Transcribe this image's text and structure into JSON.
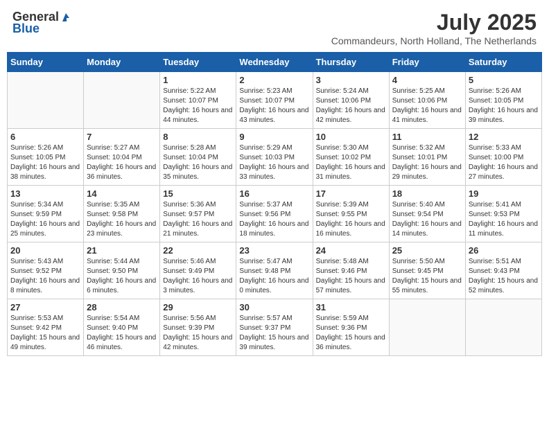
{
  "logo": {
    "general": "General",
    "blue": "Blue"
  },
  "title": "July 2025",
  "location": "Commandeurs, North Holland, The Netherlands",
  "weekdays": [
    "Sunday",
    "Monday",
    "Tuesday",
    "Wednesday",
    "Thursday",
    "Friday",
    "Saturday"
  ],
  "weeks": [
    [
      {
        "day": "",
        "info": ""
      },
      {
        "day": "",
        "info": ""
      },
      {
        "day": "1",
        "info": "Sunrise: 5:22 AM\nSunset: 10:07 PM\nDaylight: 16 hours\nand 44 minutes."
      },
      {
        "day": "2",
        "info": "Sunrise: 5:23 AM\nSunset: 10:07 PM\nDaylight: 16 hours\nand 43 minutes."
      },
      {
        "day": "3",
        "info": "Sunrise: 5:24 AM\nSunset: 10:06 PM\nDaylight: 16 hours\nand 42 minutes."
      },
      {
        "day": "4",
        "info": "Sunrise: 5:25 AM\nSunset: 10:06 PM\nDaylight: 16 hours\nand 41 minutes."
      },
      {
        "day": "5",
        "info": "Sunrise: 5:26 AM\nSunset: 10:05 PM\nDaylight: 16 hours\nand 39 minutes."
      }
    ],
    [
      {
        "day": "6",
        "info": "Sunrise: 5:26 AM\nSunset: 10:05 PM\nDaylight: 16 hours\nand 38 minutes."
      },
      {
        "day": "7",
        "info": "Sunrise: 5:27 AM\nSunset: 10:04 PM\nDaylight: 16 hours\nand 36 minutes."
      },
      {
        "day": "8",
        "info": "Sunrise: 5:28 AM\nSunset: 10:04 PM\nDaylight: 16 hours\nand 35 minutes."
      },
      {
        "day": "9",
        "info": "Sunrise: 5:29 AM\nSunset: 10:03 PM\nDaylight: 16 hours\nand 33 minutes."
      },
      {
        "day": "10",
        "info": "Sunrise: 5:30 AM\nSunset: 10:02 PM\nDaylight: 16 hours\nand 31 minutes."
      },
      {
        "day": "11",
        "info": "Sunrise: 5:32 AM\nSunset: 10:01 PM\nDaylight: 16 hours\nand 29 minutes."
      },
      {
        "day": "12",
        "info": "Sunrise: 5:33 AM\nSunset: 10:00 PM\nDaylight: 16 hours\nand 27 minutes."
      }
    ],
    [
      {
        "day": "13",
        "info": "Sunrise: 5:34 AM\nSunset: 9:59 PM\nDaylight: 16 hours\nand 25 minutes."
      },
      {
        "day": "14",
        "info": "Sunrise: 5:35 AM\nSunset: 9:58 PM\nDaylight: 16 hours\nand 23 minutes."
      },
      {
        "day": "15",
        "info": "Sunrise: 5:36 AM\nSunset: 9:57 PM\nDaylight: 16 hours\nand 21 minutes."
      },
      {
        "day": "16",
        "info": "Sunrise: 5:37 AM\nSunset: 9:56 PM\nDaylight: 16 hours\nand 18 minutes."
      },
      {
        "day": "17",
        "info": "Sunrise: 5:39 AM\nSunset: 9:55 PM\nDaylight: 16 hours\nand 16 minutes."
      },
      {
        "day": "18",
        "info": "Sunrise: 5:40 AM\nSunset: 9:54 PM\nDaylight: 16 hours\nand 14 minutes."
      },
      {
        "day": "19",
        "info": "Sunrise: 5:41 AM\nSunset: 9:53 PM\nDaylight: 16 hours\nand 11 minutes."
      }
    ],
    [
      {
        "day": "20",
        "info": "Sunrise: 5:43 AM\nSunset: 9:52 PM\nDaylight: 16 hours\nand 8 minutes."
      },
      {
        "day": "21",
        "info": "Sunrise: 5:44 AM\nSunset: 9:50 PM\nDaylight: 16 hours\nand 6 minutes."
      },
      {
        "day": "22",
        "info": "Sunrise: 5:46 AM\nSunset: 9:49 PM\nDaylight: 16 hours\nand 3 minutes."
      },
      {
        "day": "23",
        "info": "Sunrise: 5:47 AM\nSunset: 9:48 PM\nDaylight: 16 hours\nand 0 minutes."
      },
      {
        "day": "24",
        "info": "Sunrise: 5:48 AM\nSunset: 9:46 PM\nDaylight: 15 hours\nand 57 minutes."
      },
      {
        "day": "25",
        "info": "Sunrise: 5:50 AM\nSunset: 9:45 PM\nDaylight: 15 hours\nand 55 minutes."
      },
      {
        "day": "26",
        "info": "Sunrise: 5:51 AM\nSunset: 9:43 PM\nDaylight: 15 hours\nand 52 minutes."
      }
    ],
    [
      {
        "day": "27",
        "info": "Sunrise: 5:53 AM\nSunset: 9:42 PM\nDaylight: 15 hours\nand 49 minutes."
      },
      {
        "day": "28",
        "info": "Sunrise: 5:54 AM\nSunset: 9:40 PM\nDaylight: 15 hours\nand 46 minutes."
      },
      {
        "day": "29",
        "info": "Sunrise: 5:56 AM\nSunset: 9:39 PM\nDaylight: 15 hours\nand 42 minutes."
      },
      {
        "day": "30",
        "info": "Sunrise: 5:57 AM\nSunset: 9:37 PM\nDaylight: 15 hours\nand 39 minutes."
      },
      {
        "day": "31",
        "info": "Sunrise: 5:59 AM\nSunset: 9:36 PM\nDaylight: 15 hours\nand 36 minutes."
      },
      {
        "day": "",
        "info": ""
      },
      {
        "day": "",
        "info": ""
      }
    ]
  ]
}
